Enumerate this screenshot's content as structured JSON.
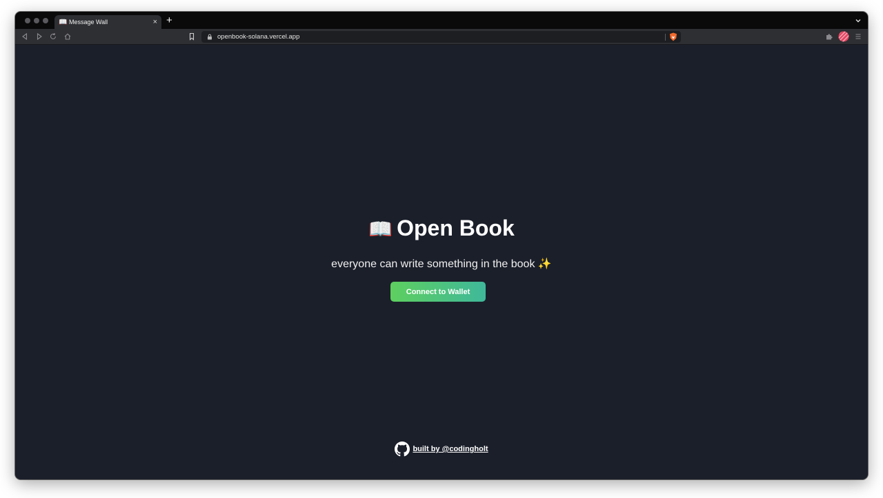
{
  "browser": {
    "tab": {
      "icon": "📖",
      "title": "Message Wall",
      "close": "×"
    },
    "new_tab": "+",
    "url": "openbook-solana.vercel.app"
  },
  "page": {
    "title_emoji": "📖",
    "title": "Open Book",
    "subtitle": "everyone can write something in the book ✨",
    "connect_button": "Connect to Wallet",
    "footer_link": "built by @codingholt"
  },
  "colors": {
    "background": "#1b1f2a",
    "button_start": "#5ecf5f",
    "button_end": "#3fb89a"
  },
  "icons": [
    "back-icon",
    "forward-icon",
    "reload-icon",
    "home-icon",
    "bookmark-icon",
    "lock-icon",
    "brave-shield-icon",
    "extensions-icon",
    "profile-avatar",
    "menu-icon",
    "github-icon"
  ]
}
